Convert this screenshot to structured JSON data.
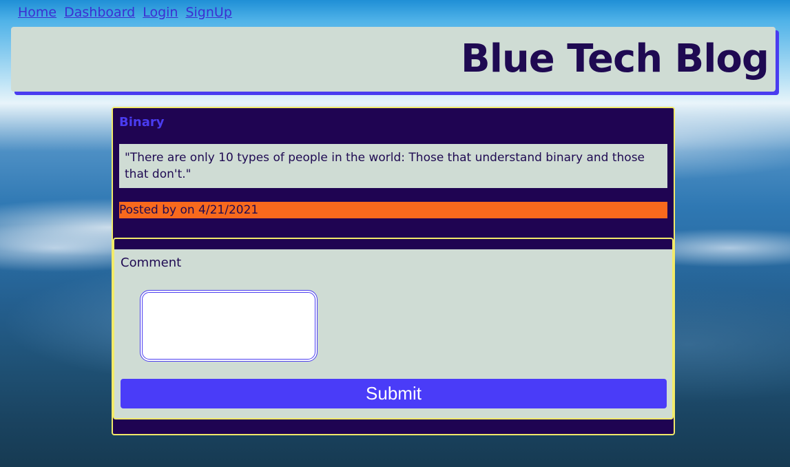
{
  "nav": {
    "items": [
      {
        "label": "Home"
      },
      {
        "label": "Dashboard"
      },
      {
        "label": "Login"
      },
      {
        "label": "SignUp"
      }
    ]
  },
  "header": {
    "title": "Blue Tech Blog"
  },
  "post": {
    "title": "Binary",
    "body": "\"There are only 10 types of people in the world: Those that understand binary and those that don't.\"",
    "meta": "Posted by on 4/21/2021"
  },
  "comment": {
    "label": "Comment",
    "value": "",
    "submit_label": "Submit"
  },
  "colors": {
    "accent": "#4a3cf0",
    "dark_purple": "#1f0452",
    "panel": "#cfdcd4",
    "orange": "#f8691d",
    "border_yellow": "#f2ea6a"
  }
}
